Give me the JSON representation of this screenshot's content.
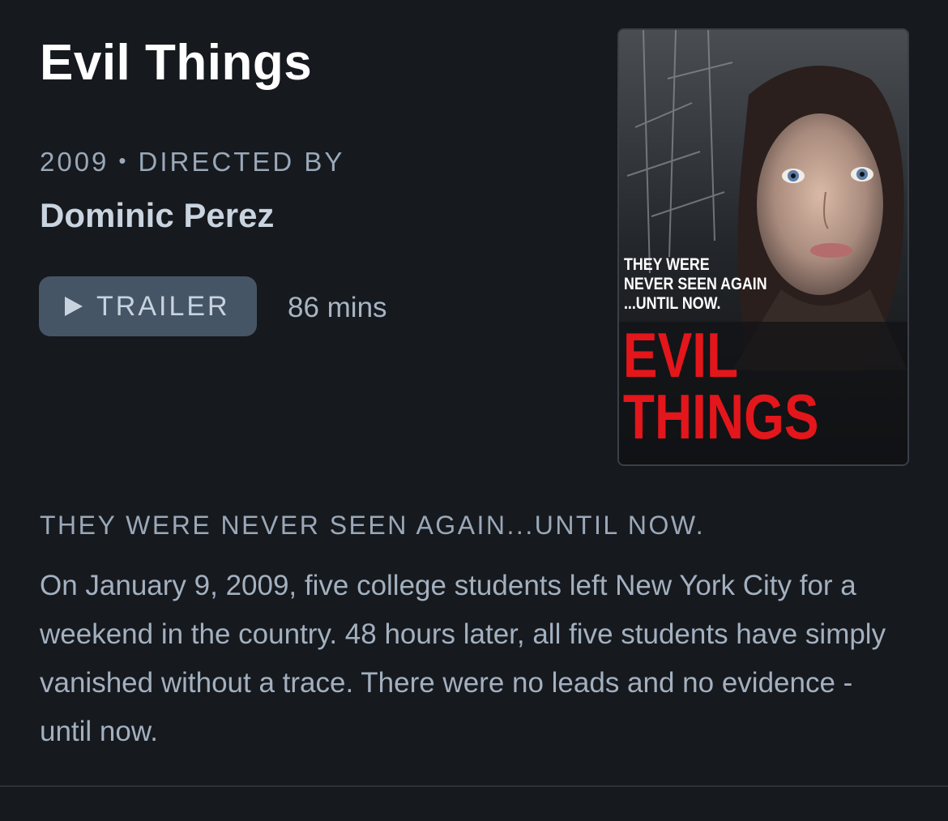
{
  "movie": {
    "title": "Evil Things",
    "year": "2009",
    "separator": "•",
    "directed_by_label": "DIRECTED BY",
    "director": "Dominic Perez",
    "trailer_label": "TRAILER",
    "runtime": "86 mins",
    "tagline": "THEY WERE NEVER SEEN AGAIN...UNTIL NOW.",
    "synopsis": "On January 9, 2009, five college students left New York City for a weekend in the country. 48 hours later, all five students have simply vanished without a trace. There were no leads and no evidence - until now."
  },
  "poster": {
    "tagline_lines": [
      "THEY WERE",
      "NEVER SEEN AGAIN",
      "...UNTIL NOW."
    ],
    "title_lines": [
      "EVIL",
      "THINGS"
    ],
    "title_color": "#e3161b"
  },
  "icons": {
    "play": "play-icon"
  }
}
